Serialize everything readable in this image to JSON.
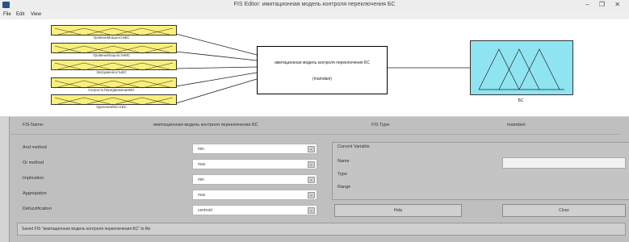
{
  "window": {
    "title": "FIS Editor: имитационная модель контроля переключения БС",
    "controls": "– ❐ ✕"
  },
  "menu": [
    "File",
    "Edit",
    "View"
  ],
  "inputs": [
    {
      "label": "УровеньМощностиБС"
    },
    {
      "label": "УровеньМощностиМС"
    },
    {
      "label": "ЗагруженностьБС"
    },
    {
      "label": "СкоростьПередвиженияМС"
    },
    {
      "label": "УдалениеМСотБС"
    }
  ],
  "system": {
    "name": "имитационная модель контроля переключения БС",
    "type_tag": "(mamdani)"
  },
  "output": {
    "label": "БС"
  },
  "fis_info": {
    "name_label": "FIS Name:",
    "name_value": "имитационная модель контроля переключения БС",
    "type_label": "FIS Type:",
    "type_value": "mamdani"
  },
  "methods": [
    {
      "label": "And method",
      "value": "min"
    },
    {
      "label": "Or method",
      "value": "max"
    },
    {
      "label": "Implication",
      "value": "min"
    },
    {
      "label": "Aggregation",
      "value": "max"
    },
    {
      "label": "Defuzzification",
      "value": "centroid"
    }
  ],
  "current_variable": {
    "title": "Current Variable",
    "name_label": "Name",
    "type_label": "Type",
    "range_label": "Range"
  },
  "buttons": {
    "help": "Help",
    "close": "Close"
  },
  "status": "Saved FIS \"имитационная модель контроля переключения БС\" to file",
  "colors": {
    "input_box": "#f9f07a",
    "output_box": "#8fe4f1",
    "panel": "#bfbfbf"
  }
}
